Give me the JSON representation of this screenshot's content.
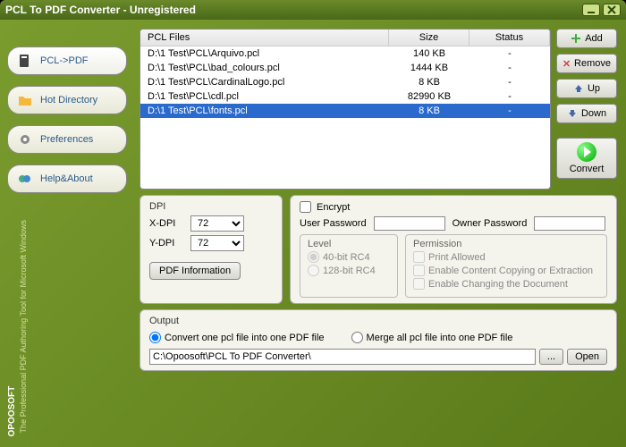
{
  "window": {
    "title": "PCL To PDF Converter - Unregistered"
  },
  "sidebar": {
    "nav": [
      {
        "label": "PCL->PDF",
        "active": true,
        "icon": "pcl-doc-icon"
      },
      {
        "label": "Hot Directory",
        "active": false,
        "icon": "folder-icon"
      },
      {
        "label": "Preferences",
        "active": false,
        "icon": "gear-icon"
      },
      {
        "label": "Help&About",
        "active": false,
        "icon": "help-icon"
      }
    ],
    "brand": "OPOOSOFT",
    "tagline": "The Professional PDF Authoring Tool for Microsoft Windows"
  },
  "filelist": {
    "headers": {
      "name": "PCL Files",
      "size": "Size",
      "status": "Status"
    },
    "rows": [
      {
        "name": "D:\\1 Test\\PCL\\Arquivo.pcl",
        "size": "140 KB",
        "status": "-",
        "selected": false
      },
      {
        "name": "D:\\1 Test\\PCL\\bad_colours.pcl",
        "size": "1444 KB",
        "status": "-",
        "selected": false
      },
      {
        "name": "D:\\1 Test\\PCL\\CardinalLogo.pcl",
        "size": "8 KB",
        "status": "-",
        "selected": false
      },
      {
        "name": "D:\\1 Test\\PCL\\cdl.pcl",
        "size": "82990 KB",
        "status": "-",
        "selected": false
      },
      {
        "name": "D:\\1 Test\\PCL\\fonts.pcl",
        "size": "8 KB",
        "status": "-",
        "selected": true
      }
    ]
  },
  "buttons": {
    "add": "Add",
    "remove": "Remove",
    "up": "Up",
    "down": "Down",
    "convert": "Convert"
  },
  "dpi": {
    "title": "DPI",
    "x_label": "X-DPI",
    "y_label": "Y-DPI",
    "x_value": "72",
    "y_value": "72",
    "pdf_info": "PDF Information"
  },
  "encrypt": {
    "checkbox_label": "Encrypt",
    "user_pwd_label": "User Password",
    "owner_pwd_label": "Owner Password",
    "level": {
      "title": "Level",
      "opt_40": "40-bit RC4",
      "opt_128": "128-bit RC4"
    },
    "permission": {
      "title": "Permission",
      "print": "Print Allowed",
      "copy": "Enable Content Copying or Extraction",
      "change": "Enable Changing the Document"
    }
  },
  "output": {
    "title": "Output",
    "opt_one": "Convert one pcl file into one PDF file",
    "opt_merge": "Merge all pcl file into one PDF file",
    "path": "C:\\Opoosoft\\PCL To PDF Converter\\",
    "browse": "...",
    "open": "Open"
  }
}
